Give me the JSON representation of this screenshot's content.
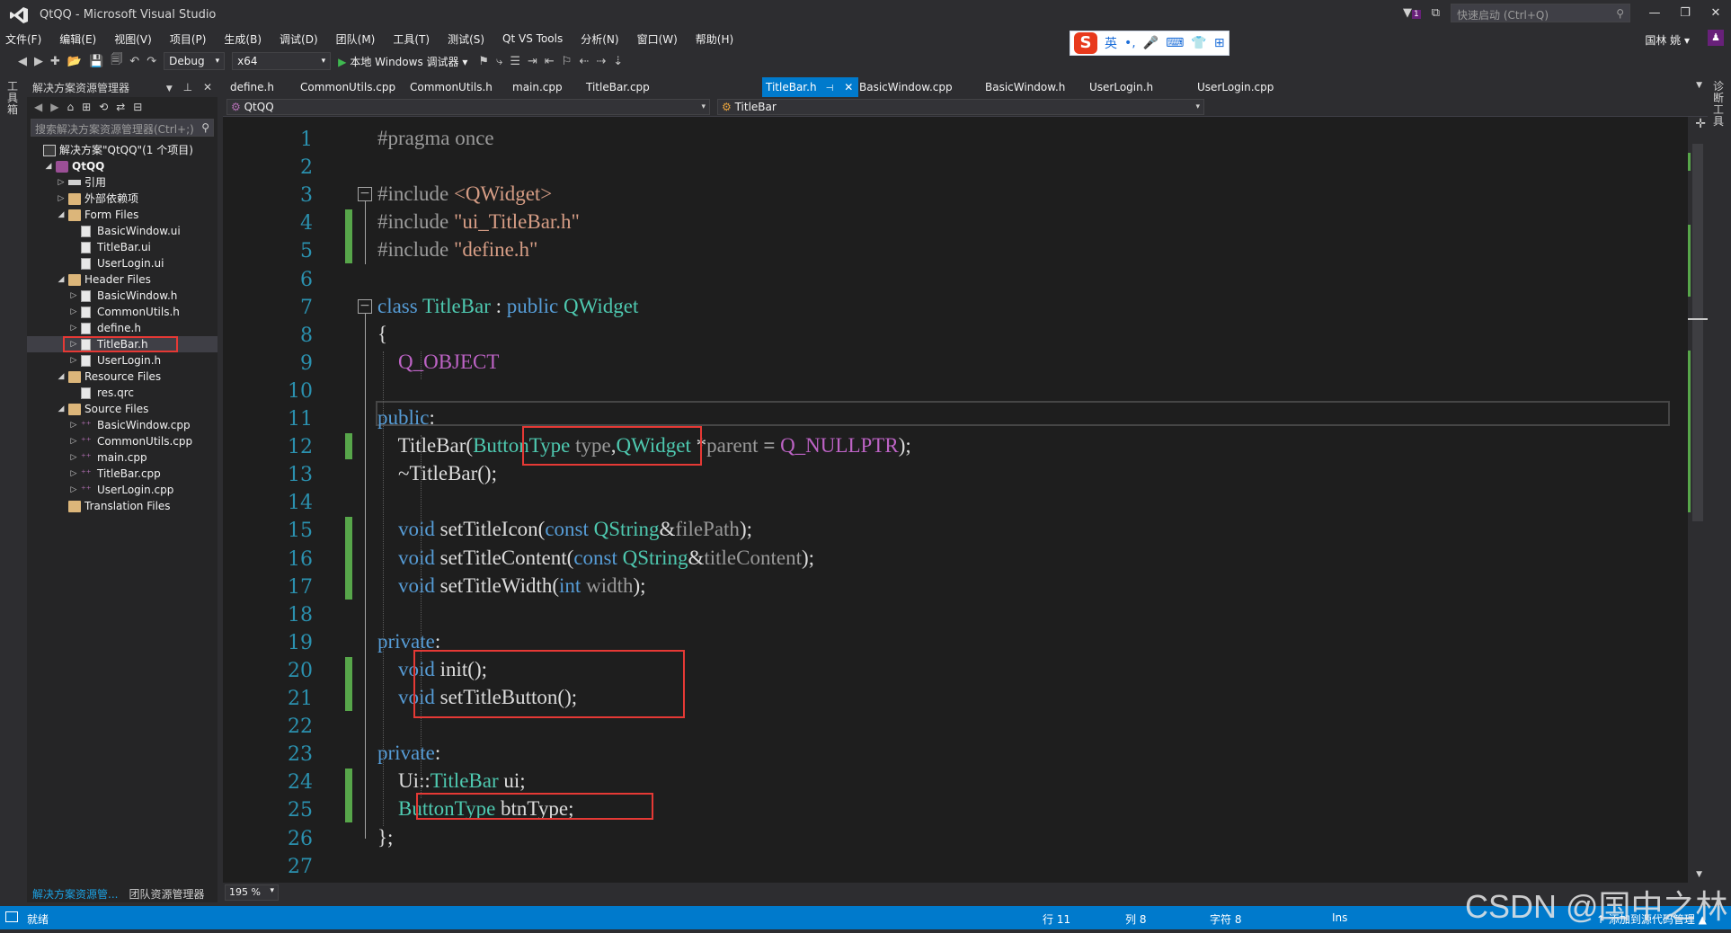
{
  "window": {
    "title": "QtQQ - Microsoft Visual Studio",
    "quick_launch_placeholder": "快速启动 (Ctrl+Q)",
    "account_name": "国林 姚",
    "filter_badge": "1"
  },
  "menu": [
    "文件(F)",
    "编辑(E)",
    "视图(V)",
    "项目(P)",
    "生成(B)",
    "调试(D)",
    "团队(M)",
    "工具(T)",
    "测试(S)",
    "Qt VS Tools",
    "分析(N)",
    "窗口(W)",
    "帮助(H)"
  ],
  "ime": {
    "mode_label": "英"
  },
  "toolbar": {
    "config": "Debug",
    "platform": "x64",
    "run_label": "本地 Windows 调试器"
  },
  "side_strips": {
    "left": "工具箱",
    "right": "诊断工具"
  },
  "explorer": {
    "title": "解决方案资源管理器",
    "search_placeholder": "搜索解决方案资源管理器(Ctrl+;)",
    "tree": [
      {
        "label": "解决方案\"QtQQ\"(1 个项目)",
        "depth": 0,
        "arrow": "",
        "icon": "sol"
      },
      {
        "label": "QtQQ",
        "depth": 1,
        "arrow": "◢",
        "icon": "proj",
        "bold": true
      },
      {
        "label": "引用",
        "depth": 2,
        "arrow": "▷",
        "icon": "ref"
      },
      {
        "label": "外部依赖项",
        "depth": 2,
        "arrow": "▷",
        "icon": "folder"
      },
      {
        "label": "Form Files",
        "depth": 2,
        "arrow": "◢",
        "icon": "folder"
      },
      {
        "label": "BasicWindow.ui",
        "depth": 3,
        "arrow": "",
        "icon": "file"
      },
      {
        "label": "TitleBar.ui",
        "depth": 3,
        "arrow": "",
        "icon": "file"
      },
      {
        "label": "UserLogin.ui",
        "depth": 3,
        "arrow": "",
        "icon": "file"
      },
      {
        "label": "Header Files",
        "depth": 2,
        "arrow": "◢",
        "icon": "folder"
      },
      {
        "label": "BasicWindow.h",
        "depth": 3,
        "arrow": "▷",
        "icon": "file"
      },
      {
        "label": "CommonUtils.h",
        "depth": 3,
        "arrow": "▷",
        "icon": "file"
      },
      {
        "label": "define.h",
        "depth": 3,
        "arrow": "▷",
        "icon": "file"
      },
      {
        "label": "TitleBar.h",
        "depth": 3,
        "arrow": "▷",
        "icon": "file",
        "selected": true
      },
      {
        "label": "UserLogin.h",
        "depth": 3,
        "arrow": "▷",
        "icon": "file"
      },
      {
        "label": "Resource Files",
        "depth": 2,
        "arrow": "◢",
        "icon": "folder"
      },
      {
        "label": "res.qrc",
        "depth": 3,
        "arrow": "",
        "icon": "qrc"
      },
      {
        "label": "Source Files",
        "depth": 2,
        "arrow": "◢",
        "icon": "folder"
      },
      {
        "label": "BasicWindow.cpp",
        "depth": 3,
        "arrow": "▷",
        "icon": "cpp"
      },
      {
        "label": "CommonUtils.cpp",
        "depth": 3,
        "arrow": "▷",
        "icon": "cpp"
      },
      {
        "label": "main.cpp",
        "depth": 3,
        "arrow": "▷",
        "icon": "cpp"
      },
      {
        "label": "TitleBar.cpp",
        "depth": 3,
        "arrow": "▷",
        "icon": "cpp"
      },
      {
        "label": "UserLogin.cpp",
        "depth": 3,
        "arrow": "▷",
        "icon": "cpp"
      },
      {
        "label": "Translation Files",
        "depth": 2,
        "arrow": "",
        "icon": "folder"
      }
    ],
    "footer_tabs": [
      "解决方案资源管...",
      "团队资源管理器"
    ]
  },
  "editor": {
    "tabs": [
      {
        "label": "define.h"
      },
      {
        "label": "CommonUtils.cpp"
      },
      {
        "label": "CommonUtils.h"
      },
      {
        "label": "main.cpp"
      },
      {
        "label": "TitleBar.cpp"
      },
      {
        "label": "TitleBar.h",
        "active": true
      },
      {
        "label": "BasicWindow.cpp"
      },
      {
        "label": "BasicWindow.h"
      },
      {
        "label": "UserLogin.h"
      },
      {
        "label": "UserLogin.cpp"
      }
    ],
    "nav_project": "QtQQ",
    "nav_scope": "TitleBar",
    "zoom": "195 %",
    "lines": [
      [
        [
          "pp",
          "#pragma once"
        ]
      ],
      [],
      [
        [
          "pp",
          "#include "
        ],
        [
          "str",
          "<QWidget>"
        ]
      ],
      [
        [
          "pp",
          "#include "
        ],
        [
          "str",
          "\"ui_TitleBar.h\""
        ]
      ],
      [
        [
          "pp",
          "#include "
        ],
        [
          "str",
          "\"define.h\""
        ]
      ],
      [],
      [
        [
          "kw",
          "class "
        ],
        [
          "ty",
          "TitleBar"
        ],
        [
          "plain",
          " : "
        ],
        [
          "kw",
          "public "
        ],
        [
          "ty",
          "QWidget"
        ]
      ],
      [
        [
          "plain",
          "{"
        ]
      ],
      [
        [
          "plain",
          "    "
        ],
        [
          "mac",
          "Q_OBJECT"
        ]
      ],
      [],
      [
        [
          "kw",
          "public"
        ],
        [
          "plain",
          ":"
        ]
      ],
      [
        [
          "plain",
          "    TitleBar("
        ],
        [
          "ty",
          "ButtonType"
        ],
        [
          "prm",
          " type"
        ],
        [
          "plain",
          ","
        ],
        [
          "ty",
          "QWidget"
        ],
        [
          "plain",
          " *"
        ],
        [
          "prm",
          "parent"
        ],
        [
          "plain",
          " = "
        ],
        [
          "mac",
          "Q_NULLPTR"
        ],
        [
          "plain",
          ");"
        ]
      ],
      [
        [
          "plain",
          "    ~TitleBar();"
        ]
      ],
      [],
      [
        [
          "plain",
          "    "
        ],
        [
          "kw",
          "void"
        ],
        [
          "plain",
          " setTitleIcon("
        ],
        [
          "kw",
          "const "
        ],
        [
          "ty",
          "QString"
        ],
        [
          "plain",
          "&"
        ],
        [
          "prm",
          "filePath"
        ],
        [
          "plain",
          ");"
        ]
      ],
      [
        [
          "plain",
          "    "
        ],
        [
          "kw",
          "void"
        ],
        [
          "plain",
          " setTitleContent("
        ],
        [
          "kw",
          "const "
        ],
        [
          "ty",
          "QString"
        ],
        [
          "plain",
          "&"
        ],
        [
          "prm",
          "titleContent"
        ],
        [
          "plain",
          ");"
        ]
      ],
      [
        [
          "plain",
          "    "
        ],
        [
          "kw",
          "void"
        ],
        [
          "plain",
          " setTitleWidth("
        ],
        [
          "kw",
          "int"
        ],
        [
          "prm",
          " width"
        ],
        [
          "plain",
          ");"
        ]
      ],
      [],
      [
        [
          "kw",
          "private"
        ],
        [
          "plain",
          ":"
        ]
      ],
      [
        [
          "plain",
          "    "
        ],
        [
          "kw",
          "void"
        ],
        [
          "plain",
          " init();"
        ]
      ],
      [
        [
          "plain",
          "    "
        ],
        [
          "kw",
          "void"
        ],
        [
          "plain",
          " setTitleButton();"
        ]
      ],
      [],
      [
        [
          "kw",
          "private"
        ],
        [
          "plain",
          ":"
        ]
      ],
      [
        [
          "plain",
          "    Ui::"
        ],
        [
          "ty",
          "TitleBar"
        ],
        [
          "plain",
          " ui;"
        ]
      ],
      [
        [
          "plain",
          "    "
        ],
        [
          "ty",
          "ButtonType"
        ],
        [
          "plain",
          " btnType;"
        ]
      ],
      [
        [
          "plain",
          "};"
        ]
      ],
      []
    ]
  },
  "status": {
    "ready": "就绪",
    "line": "行 11",
    "col": "列 8",
    "char": "字符 8",
    "mode": "Ins",
    "source_control": "↑ 添加到源代码管理 ▲"
  },
  "watermark": "CSDN @国中之林"
}
